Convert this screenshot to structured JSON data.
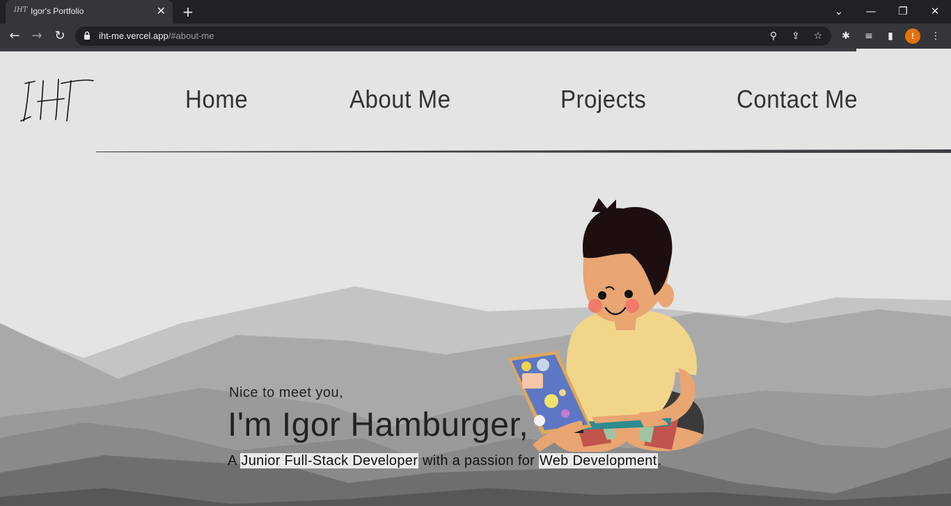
{
  "browser": {
    "tab_title": "Igor's Portfolio",
    "tab_favicon": "IHT",
    "tab_close": "✕",
    "new_tab": "+",
    "url_host": "iht-me.vercel.app",
    "url_path": "/#about-me",
    "window_controls": {
      "minimize": "—",
      "restore": "❐",
      "close": "✕",
      "tabsearch": "⌄"
    },
    "profile_badge": "!"
  },
  "site": {
    "logo_text": "IHT",
    "nav": [
      {
        "label": "Home"
      },
      {
        "label": "About Me"
      },
      {
        "label": "Projects"
      },
      {
        "label": "Contact Me"
      }
    ]
  },
  "hero": {
    "greeting": "Nice to meet you,",
    "name": "I'm Igor Hamburger,",
    "tagline_prefix": "A ",
    "tagline_role": "Junior Full-Stack Developer",
    "tagline_mid": " with a passion for ",
    "tagline_field": "Web Development",
    "tagline_suffix": "."
  },
  "colors": {
    "chrome_dark": "#202124",
    "chrome_mid": "#35363a",
    "page_bg": "#e4e4e4",
    "accent_profile": "#e8710a"
  }
}
